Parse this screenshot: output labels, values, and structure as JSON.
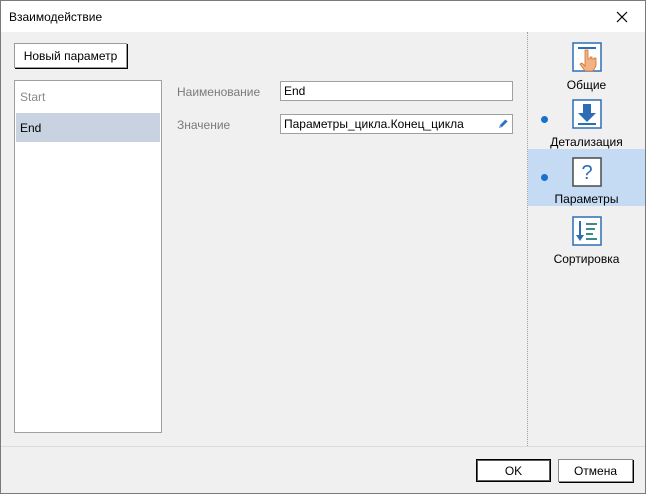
{
  "window": {
    "title": "Взаимодействие"
  },
  "toolbar": {
    "new_param_label": "Новый параметр"
  },
  "params": {
    "items": [
      {
        "label": "Start",
        "selected": false
      },
      {
        "label": "End",
        "selected": true
      }
    ]
  },
  "form": {
    "name_label": "Наименование",
    "name_value": "End",
    "value_label": "Значение",
    "value_value": "Параметры_цикла.Конец_цикла"
  },
  "nav": {
    "items": [
      {
        "label": "Общие",
        "icon": "hand-pointer-icon",
        "has_dot": false,
        "active": false
      },
      {
        "label": "Детализация",
        "icon": "arrow-down-icon",
        "has_dot": true,
        "active": false
      },
      {
        "label": "Параметры",
        "icon": "question-icon",
        "has_dot": true,
        "active": true
      },
      {
        "label": "Сортировка",
        "icon": "sort-icon",
        "has_dot": false,
        "active": false
      }
    ]
  },
  "footer": {
    "ok_label": "OK",
    "cancel_label": "Отмена"
  },
  "colors": {
    "accent": "#1a6fd0",
    "active_nav": "#c5dbf4",
    "selected_row": "#c8d2e0"
  }
}
